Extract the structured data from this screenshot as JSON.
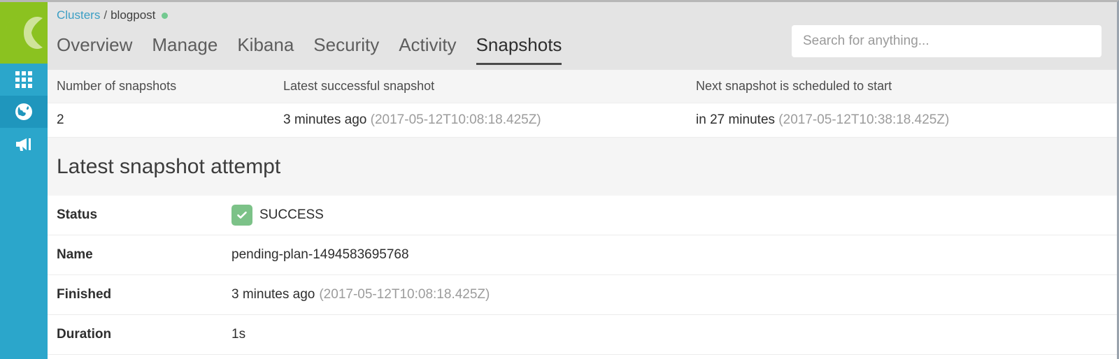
{
  "sidebar": {
    "logo_name": "elastic-cloud-logo",
    "items": [
      {
        "icon": "grid-apps-icon",
        "label": "Apps",
        "active": false
      },
      {
        "icon": "globe-icon",
        "label": "Deployments",
        "active": true
      },
      {
        "icon": "megaphone-icon",
        "label": "Announcements",
        "active": false
      }
    ]
  },
  "header": {
    "breadcrumb": {
      "root": "Clusters",
      "separator": "/",
      "current": "blogpost",
      "status_color": "#73c990"
    },
    "tabs": [
      {
        "label": "Overview",
        "active": false
      },
      {
        "label": "Manage",
        "active": false
      },
      {
        "label": "Kibana",
        "active": false
      },
      {
        "label": "Security",
        "active": false
      },
      {
        "label": "Activity",
        "active": false
      },
      {
        "label": "Snapshots",
        "active": true
      }
    ],
    "search": {
      "placeholder": "Search for anything...",
      "value": ""
    }
  },
  "summary": {
    "columns": [
      "Number of snapshots",
      "Latest successful snapshot",
      "Next snapshot is scheduled to start"
    ],
    "values": {
      "count": "2",
      "latest_relative": "3 minutes ago",
      "latest_absolute": "(2017-05-12T10:08:18.425Z)",
      "next_relative": "in 27 minutes",
      "next_absolute": "(2017-05-12T10:38:18.425Z)"
    }
  },
  "section": {
    "title": "Latest snapshot attempt"
  },
  "details": {
    "status": {
      "label": "Status",
      "value": "SUCCESS",
      "badge_color": "#7cc288",
      "badge_icon": "check-icon"
    },
    "name": {
      "label": "Name",
      "value": "pending-plan-1494583695768"
    },
    "finished": {
      "label": "Finished",
      "relative": "3 minutes ago",
      "absolute": "(2017-05-12T10:08:18.425Z)"
    },
    "duration": {
      "label": "Duration",
      "value": "1s"
    }
  }
}
